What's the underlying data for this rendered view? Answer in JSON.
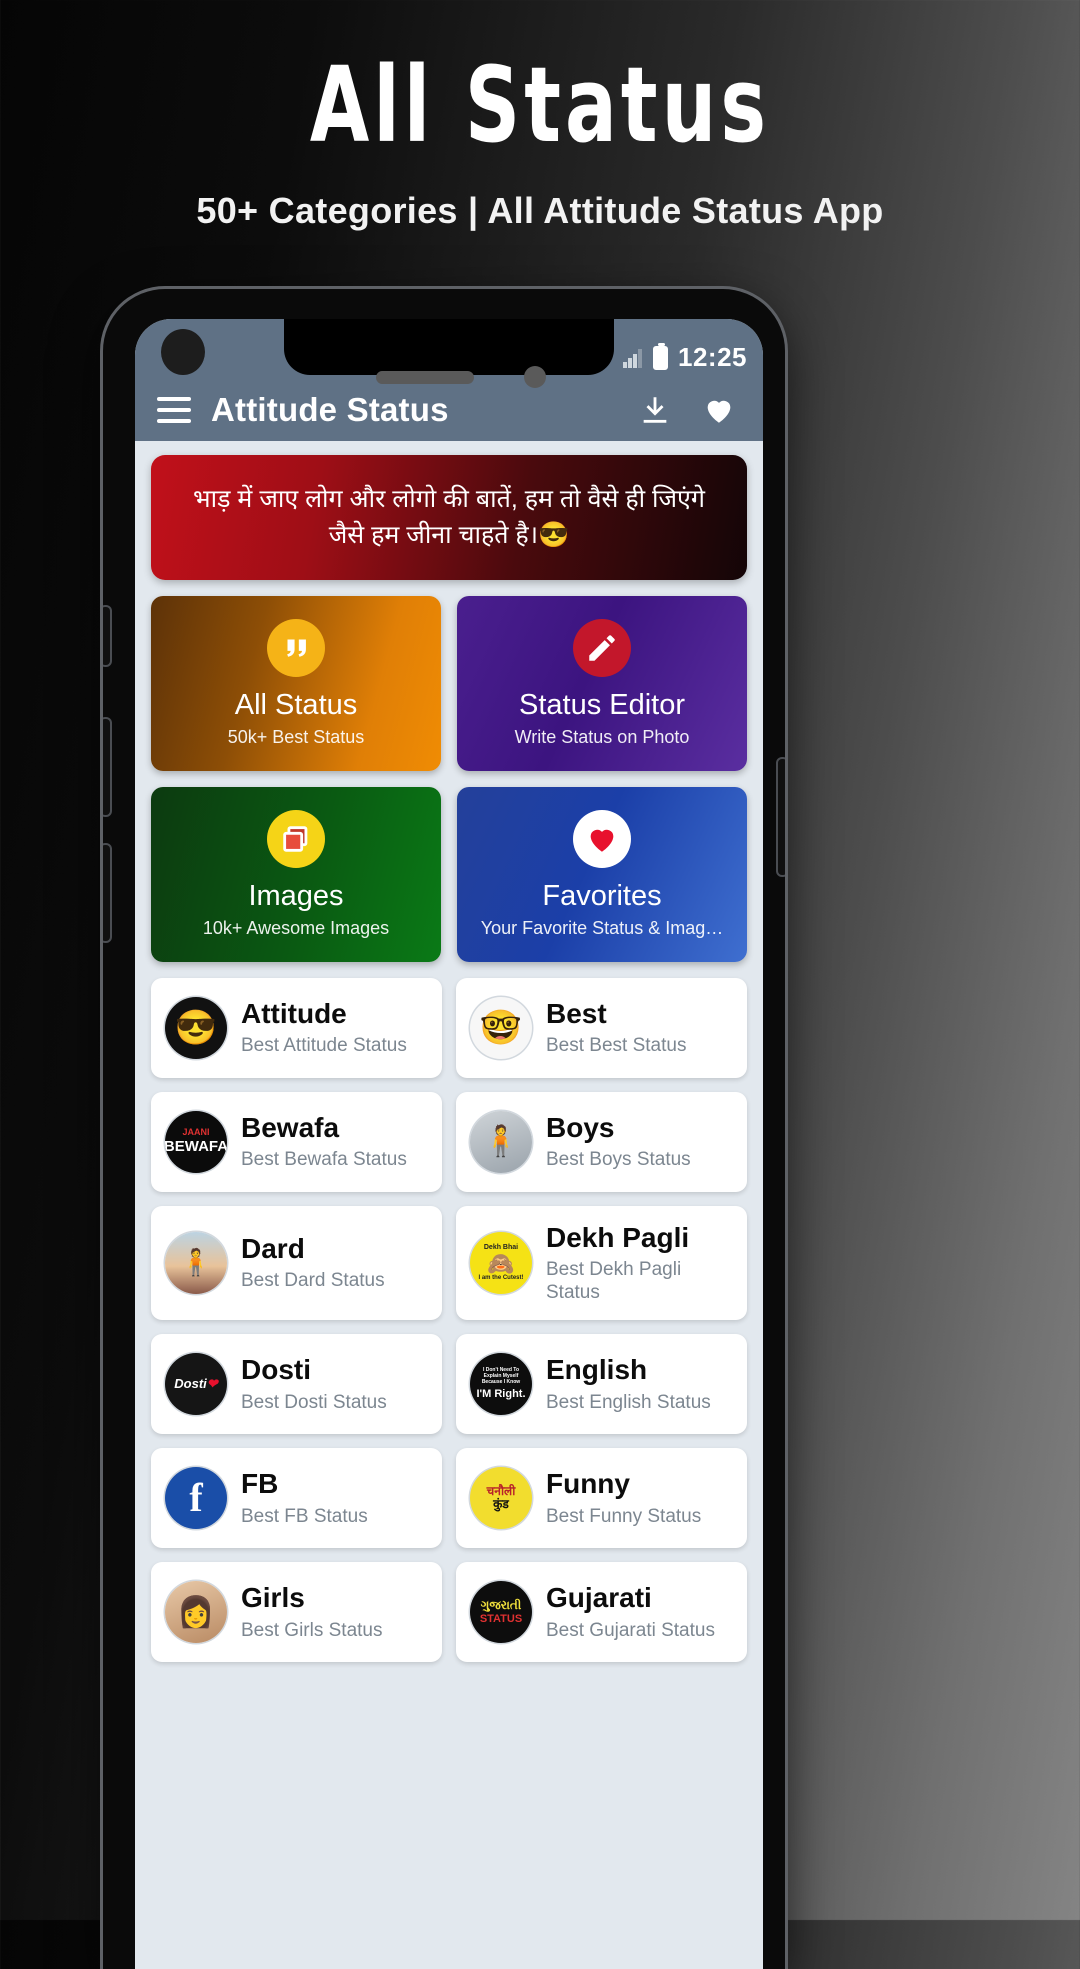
{
  "promo": {
    "title": "All Status",
    "subtitle": "50+ Categories | All Attitude Status App"
  },
  "statusbar": {
    "time": "12:25"
  },
  "appbar": {
    "title": "Attitude Status",
    "menu_icon": "hamburger-menu-icon",
    "download_icon": "download-icon",
    "favorite_icon": "heart-icon"
  },
  "quote": {
    "text": "भाड़ में जाए लोग और लोगो की बातें, हम तो वैसे ही जिएंगे जैसे हम जीना चाहते है।😎"
  },
  "tiles": [
    {
      "title": "All Status",
      "sub": "50k+ Best Status",
      "icon": "quote-icon"
    },
    {
      "title": "Status Editor",
      "sub": "Write Status on Photo",
      "icon": "pencil-icon"
    },
    {
      "title": "Images",
      "sub": "10k+ Awesome Images",
      "icon": "photos-icon"
    },
    {
      "title": "Favorites",
      "sub": "Your Favorite Status & Imag…",
      "icon": "heart-icon"
    }
  ],
  "categories": [
    {
      "name": "Attitude",
      "sub": "Best Attitude Status",
      "icon": "sunglasses-emoji-avatar"
    },
    {
      "name": "Best",
      "sub": "Best Best Status",
      "icon": "rainbow-sunglasses-emoji-avatar"
    },
    {
      "name": "Bewafa",
      "sub": "Best Bewafa Status",
      "icon": "bewafa-text-avatar"
    },
    {
      "name": "Boys",
      "sub": "Best Boys Status",
      "icon": "boy-photo-avatar"
    },
    {
      "name": "Dard",
      "sub": "Best Dard Status",
      "icon": "sunset-silhouette-avatar"
    },
    {
      "name": "Dekh Pagli",
      "sub": "Best Dekh Pagli Status",
      "icon": "dekh-bhai-yellow-avatar"
    },
    {
      "name": "Dosti",
      "sub": "Best Dosti Status",
      "icon": "dosti-heart-avatar"
    },
    {
      "name": "English",
      "sub": "Best English Status",
      "icon": "english-quote-avatar"
    },
    {
      "name": "FB",
      "sub": "Best FB Status",
      "icon": "facebook-avatar"
    },
    {
      "name": "Funny",
      "sub": "Best Funny Status",
      "icon": "funny-hindi-avatar"
    },
    {
      "name": "Girls",
      "sub": "Best Girls Status",
      "icon": "girl-photo-avatar"
    },
    {
      "name": "Gujarati",
      "sub": "Best Gujarati Status",
      "icon": "gujarati-status-avatar"
    }
  ],
  "avatar_text": {
    "bewafa_top": "JAANI",
    "bewafa_main": "BEWAFA",
    "dekh_top": "Dekh Bhai",
    "dekh_bottom": "I am the Cutest!",
    "english_1": "I Don't Need To",
    "english_2": "Explain Myself",
    "english_3": "Because I Know",
    "english_4": "I'M Right.",
    "dosti": "Dosti",
    "funny_1": "चनौली",
    "funny_2": "कुंड",
    "gujarati_1": "ગુજરાતી",
    "gujarati_2": "STATUS"
  }
}
